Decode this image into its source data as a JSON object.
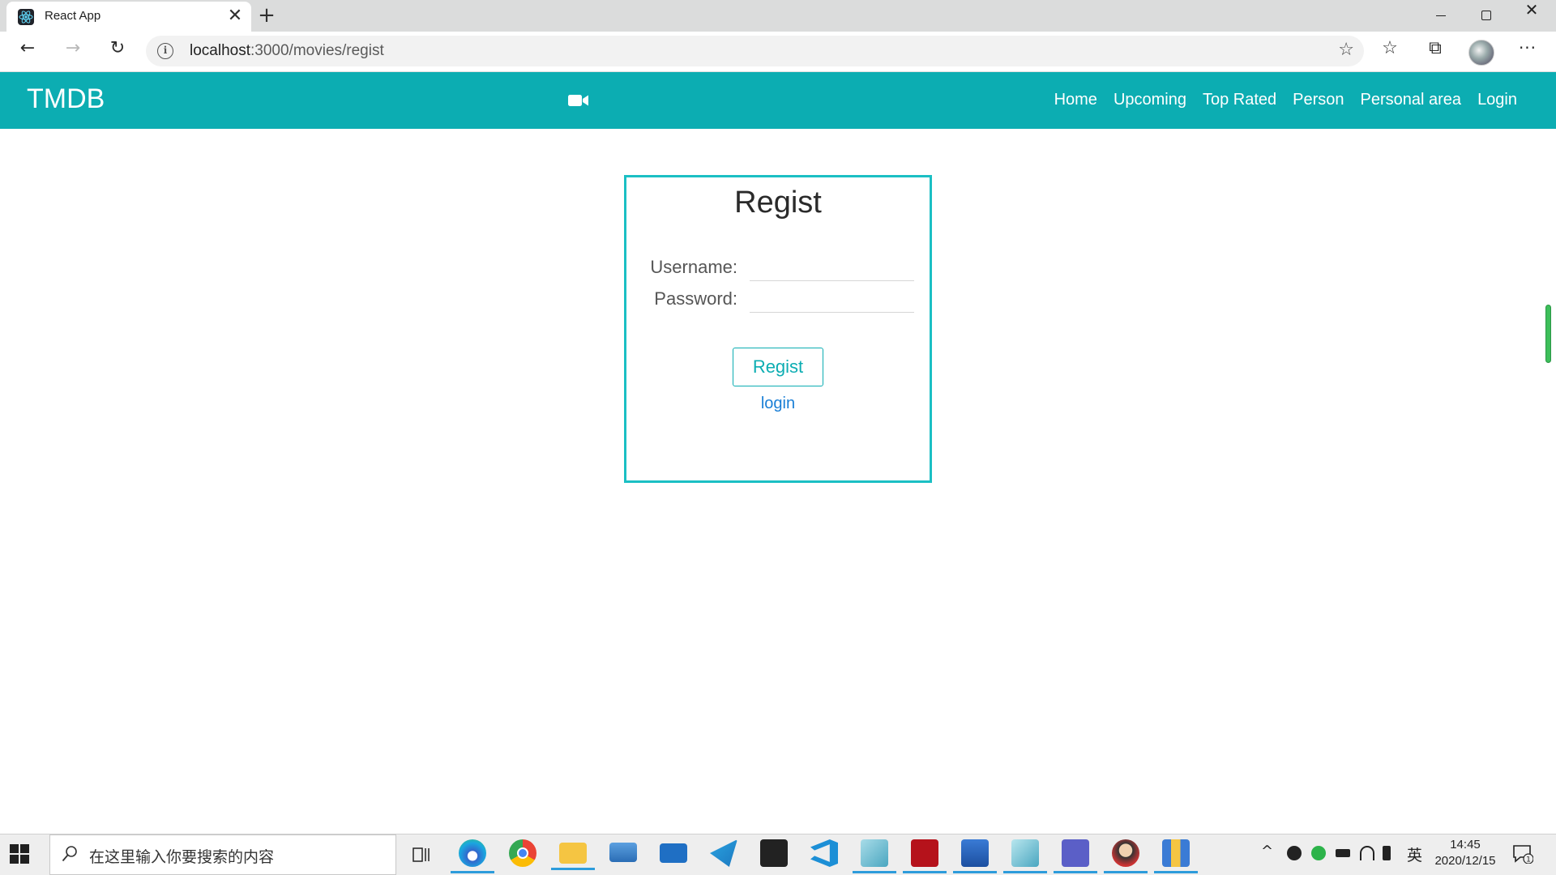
{
  "browser": {
    "tab_title": "React App",
    "close_glyph": "✕",
    "new_tab_glyph": "+",
    "url_host": "localhost",
    "url_path": ":3000/movies/regist",
    "info_glyph": "i",
    "star_glyph": "☆",
    "back_glyph": "←",
    "forward_glyph": "→",
    "reload_glyph": "↻",
    "favorites_glyph": "☆",
    "collections_glyph": "⧉",
    "more_glyph": "···",
    "win_close_glyph": "✕"
  },
  "navbar": {
    "brand": "TMDB",
    "links": [
      "Home",
      "Upcoming",
      "Top Rated",
      "Person",
      "Personal area",
      "Login"
    ],
    "color": "#0cadb2"
  },
  "regist_form": {
    "title": "Regist",
    "username_label": "Username:",
    "password_label": "Password:",
    "username_value": "",
    "password_value": "",
    "submit_label": "Regist",
    "login_link": "login",
    "border_color": "#1bbfc4"
  },
  "taskbar": {
    "search_placeholder": "在这里输入你要搜索的内容",
    "input_lang": "英",
    "time": "14:45",
    "date": "2020/12/15",
    "tray_chevron": "^",
    "notifications_badge": "1"
  },
  "icons": {
    "camera": "video-camera-icon",
    "search": "search-icon",
    "start": "windows-start-icon"
  }
}
